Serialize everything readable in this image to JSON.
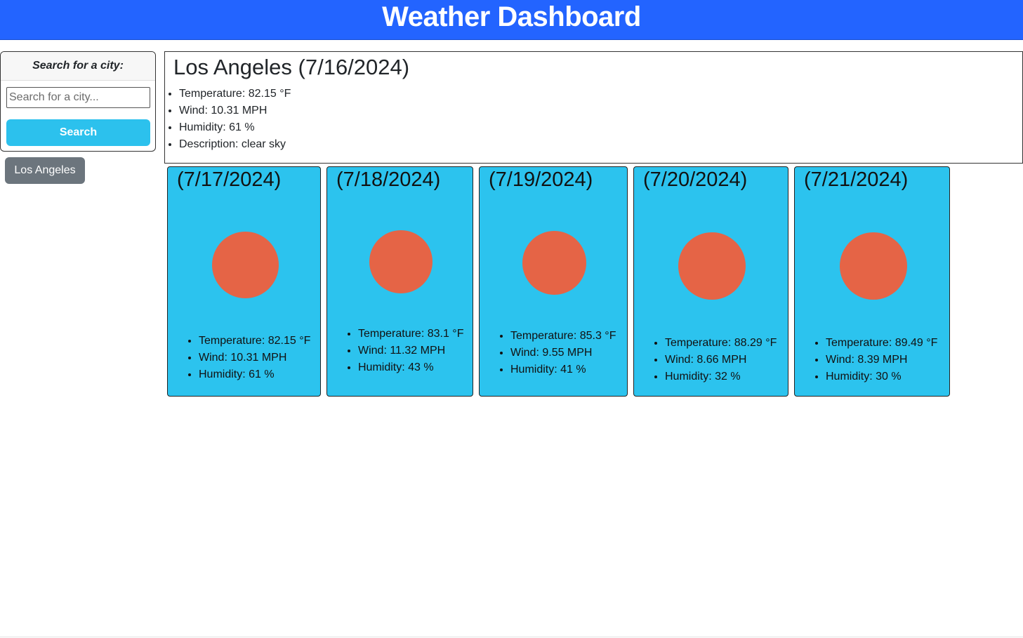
{
  "header": {
    "title": "Weather Dashboard"
  },
  "sidebar": {
    "search_heading": "Search for a city:",
    "search_placeholder": "Search for a city...",
    "search_value": "",
    "search_button": "Search",
    "history": [
      "Los Angeles"
    ]
  },
  "current": {
    "title": "Los Angeles (7/16/2024)",
    "temperature": "Temperature: 82.15 °F",
    "wind": "Wind: 10.31 MPH",
    "humidity": "Humidity: 61 %",
    "description": "Description: clear sky"
  },
  "forecast": [
    {
      "date": "(7/17/2024)",
      "icon": "sun-icon",
      "temperature": "Temperature: 82.15 °F",
      "wind": "Wind: 10.31 MPH",
      "humidity": "Humidity: 61 %"
    },
    {
      "date": "(7/18/2024)",
      "icon": "sun-icon",
      "temperature": "Temperature: 83.1 °F",
      "wind": "Wind: 11.32 MPH",
      "humidity": "Humidity: 43 %"
    },
    {
      "date": "(7/19/2024)",
      "icon": "sun-icon",
      "temperature": "Temperature: 85.3 °F",
      "wind": "Wind: 9.55 MPH",
      "humidity": "Humidity: 41 %"
    },
    {
      "date": "(7/20/2024)",
      "icon": "sun-icon",
      "temperature": "Temperature: 88.29 °F",
      "wind": "Wind: 8.66 MPH",
      "humidity": "Humidity: 32 %"
    },
    {
      "date": "(7/21/2024)",
      "icon": "sun-icon",
      "temperature": "Temperature: 89.49 °F",
      "wind": "Wind: 8.39 MPH",
      "humidity": "Humidity: 30 %"
    }
  ],
  "colors": {
    "header_bg": "#2364ff",
    "card_bg": "#2cc3ee",
    "sun": "#e56446",
    "search_button": "#2cc1ed",
    "history_button": "#6c757d"
  }
}
